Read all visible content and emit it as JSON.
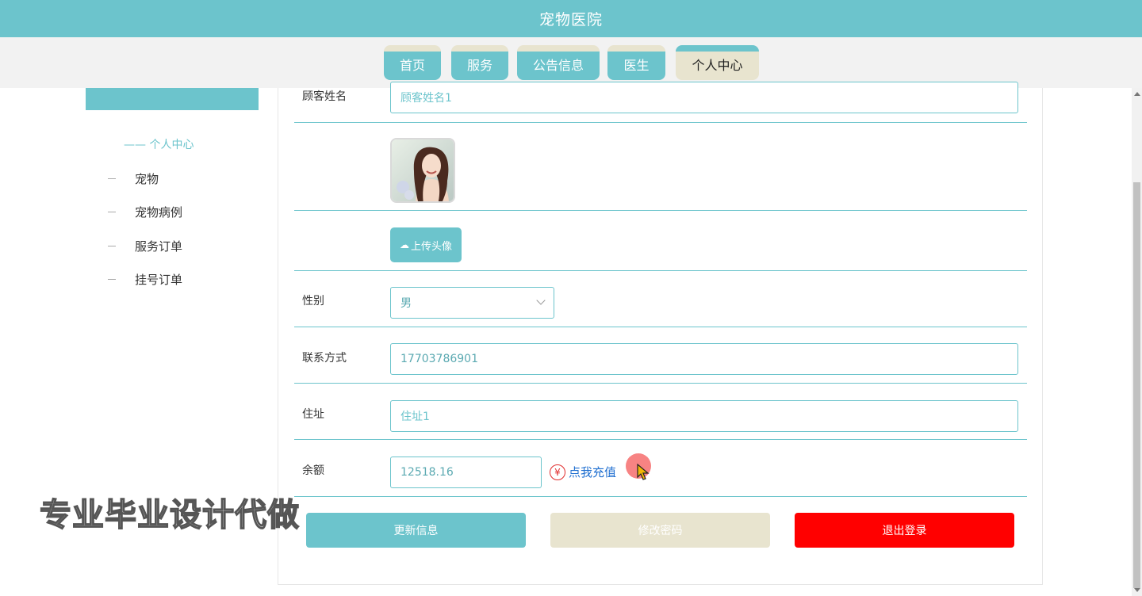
{
  "header": {
    "title": "宠物医院"
  },
  "nav": {
    "tabs": [
      {
        "label": "首页"
      },
      {
        "label": "服务"
      },
      {
        "label": "公告信息"
      },
      {
        "label": "医生"
      },
      {
        "label": "个人中心",
        "active": true
      }
    ]
  },
  "sidebar": {
    "title": "—— 个人中心",
    "items": [
      {
        "label": "宠物"
      },
      {
        "label": "宠物病例"
      },
      {
        "label": "服务订单"
      },
      {
        "label": "挂号订单"
      }
    ]
  },
  "form": {
    "name_label": "顾客姓名",
    "name_value": "顾客姓名1",
    "upload_label": "上传头像",
    "gender_label": "性别",
    "gender_value": "男",
    "phone_label": "联系方式",
    "phone_value": "17703786901",
    "address_label": "住址",
    "address_value": "住址1",
    "balance_label": "余额",
    "balance_value": "12518.16",
    "recharge_label": "点我充值",
    "yen_symbol": "¥"
  },
  "buttons": {
    "update": "更新信息",
    "change_password": "修改密码",
    "logout": "退出登录"
  },
  "watermark": "专业毕业设计代做",
  "colors": {
    "accent": "#6cc4cc",
    "secondary": "#e8e4cf",
    "danger": "#ff0000",
    "link": "#1f6fd0"
  }
}
